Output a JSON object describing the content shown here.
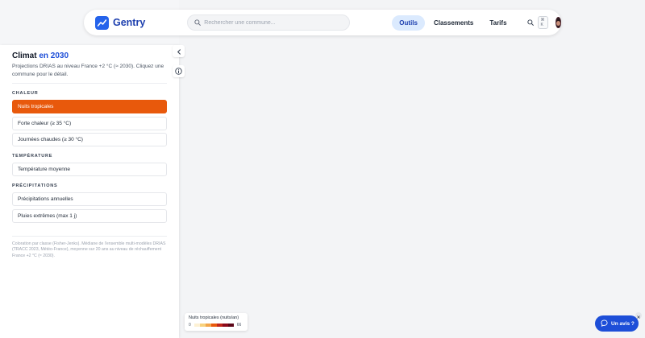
{
  "header": {
    "brand": "Gentry",
    "search_placeholder": "Rechercher une commune...",
    "nav": [
      {
        "label": "Outils",
        "active": true
      },
      {
        "label": "Classements",
        "active": false
      },
      {
        "label": "Tarifs",
        "active": false
      }
    ],
    "shortcut": "⌘ K"
  },
  "sidebar": {
    "title_main": "Climat",
    "title_accent": "en 2030",
    "subtitle": "Projections DRIAS au niveau France +2 °C (≈ 2030). Cliquez une commune pour le détail.",
    "sections": [
      {
        "label": "CHALEUR",
        "items": [
          {
            "label": "Nuits tropicales",
            "selected": true
          },
          {
            "label": "Forte chaleur (≥ 35 °C)",
            "selected": false
          },
          {
            "label": "Journées chaudes (≥ 30 °C)",
            "selected": false
          }
        ]
      },
      {
        "label": "TEMPÉRATURE",
        "items": [
          {
            "label": "Température moyenne",
            "selected": false
          }
        ]
      },
      {
        "label": "PRÉCIPITATIONS",
        "items": [
          {
            "label": "Précipitations annuelles",
            "selected": false
          },
          {
            "label": "Pluies extrêmes (max 1 j)",
            "selected": false
          }
        ]
      }
    ],
    "footnote": "Coloration par classe (Fisher-Jenks). Médiane de l'ensemble multi-modèles DRIAS (TRACC 2023, Météo-France), moyenne sur 20 ans au niveau de réchauffement France +2 °C (≈ 2030)."
  },
  "legend": {
    "title": "Nuits tropicales (nuits/an)",
    "min": "0",
    "max": "66",
    "colors": [
      "#fdf1d4",
      "#f8d27e",
      "#f2a54a",
      "#e8590c",
      "#c0261a",
      "#8b0a1a",
      "#5c0618"
    ]
  },
  "feedback": {
    "label": "Un avis ?"
  },
  "colors": {
    "accent": "#1d4ed8",
    "selected": "#e8590c"
  }
}
